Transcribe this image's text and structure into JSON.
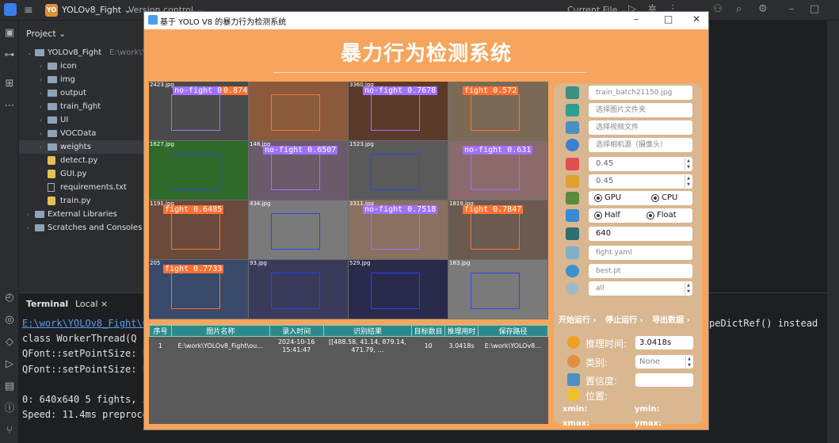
{
  "ide": {
    "project_badge": "YO",
    "project_name": "YOLOv8_Fight",
    "version_control": "Version control",
    "current_file": "Current File",
    "project_header": "Project",
    "tree": [
      {
        "name": "YOLOv8_Fight",
        "path": "E:\\work\\YO",
        "type": "root"
      },
      {
        "name": "icon",
        "type": "folder"
      },
      {
        "name": "img",
        "type": "folder"
      },
      {
        "name": "output",
        "type": "folder"
      },
      {
        "name": "train_fight",
        "type": "folder"
      },
      {
        "name": "UI",
        "type": "folder"
      },
      {
        "name": "VOCData",
        "type": "folder"
      },
      {
        "name": "weights",
        "type": "folder"
      },
      {
        "name": "detect.py",
        "type": "py"
      },
      {
        "name": "GUI.py",
        "type": "py"
      },
      {
        "name": "requirements.txt",
        "type": "txt"
      },
      {
        "name": "train.py",
        "type": "py"
      },
      {
        "name": "External Libraries",
        "type": "lib"
      },
      {
        "name": "Scratches and Consoles",
        "type": "lib"
      }
    ],
    "terminal": {
      "header": "Terminal",
      "tab": "Local",
      "lines": [
        "E:\\work\\YOLOv8_Fight\\G",
        "  class WorkerThread(Q",
        "QFont::setPointSize: P",
        "QFont::setPointSize: P",
        "",
        "0: 640x640 5 fights, 5",
        "Speed: 11.4ms preproce"
      ],
      "right_text": "peDictRef() instead"
    }
  },
  "app": {
    "window_title": "基于 YOLO V8 的暴力行为检测系统",
    "title": "暴力行为检测系统",
    "tiles": [
      {
        "file": "2423.jpg",
        "label": "no-fight 0.6618",
        "label2": "0.874"
      },
      {
        "file": "",
        "label": "",
        "label2": ""
      },
      {
        "file": "3360.jpg",
        "label": "no-fight 0.7678",
        "label2": ""
      },
      {
        "file": "",
        "label": "fight 0.572",
        "label2": ""
      },
      {
        "file": "1627.jpg",
        "label": "",
        "label2": ""
      },
      {
        "file": "148.jpg",
        "label": "no-fight 0.6507",
        "label2": ""
      },
      {
        "file": "1523.jpg",
        "label": "",
        "label2": ""
      },
      {
        "file": "",
        "label": "no-fight 0.631",
        "label2": ""
      },
      {
        "file": "1191.jpg",
        "label": "fight 0.6485",
        "label2": ""
      },
      {
        "file": "434.jpg",
        "label": "",
        "label2": ""
      },
      {
        "file": "3311.jpg",
        "label": "no-fight 0.7518",
        "label2": ""
      },
      {
        "file": "1819.jpg",
        "label": "fight 0.7847",
        "label2": ""
      },
      {
        "file": "205",
        "label": "fight 0.7733",
        "label2": ""
      },
      {
        "file": "93.jpg",
        "label": "",
        "label2": ""
      },
      {
        "file": "529.jpg",
        "label": "",
        "label2": ""
      },
      {
        "file": "183.jpg",
        "label": "",
        "label2": ""
      }
    ],
    "table": {
      "headers": [
        "序号",
        "图片名称",
        "录入时间",
        "识别结果",
        "目标数目",
        "推理用时",
        "保存路径"
      ],
      "rows": [
        [
          "1",
          "E:\\work\\YOLOv8_Fight\\ou…",
          "2024-10-16 15:41:47",
          "[[488.58, 41.14, 879.14, 471.79, …",
          "10",
          "3.0418s",
          "E:\\work\\YOLOv8…"
        ]
      ]
    },
    "panel": {
      "image_path": "train_batch21150.jpg",
      "select_folder": "选择图片文件夹",
      "select_video": "选择视频文件",
      "select_camera": "选择相机源（摄像头）",
      "conf": "0.45",
      "iou": "0.45",
      "gpu": "GPU",
      "cpu": "CPU",
      "half": "Half",
      "float": "Float",
      "imgsz": "640",
      "yaml": "fight.yaml",
      "weights": "best.pt",
      "classes": "all",
      "start": "开始运行 ›",
      "stop": "停止运行 ›",
      "export": "导出数据 ›",
      "infer_time_label": "推理时间:",
      "infer_time": "3.0418s",
      "class_label": "类别:",
      "class_value": "None",
      "conf_label": "置信度:",
      "conf_value": "",
      "pos_label": "位置:",
      "xmin": "xmin:",
      "ymin": "ymin:",
      "xmax": "xmax:",
      "ymax": "ymax:"
    }
  }
}
